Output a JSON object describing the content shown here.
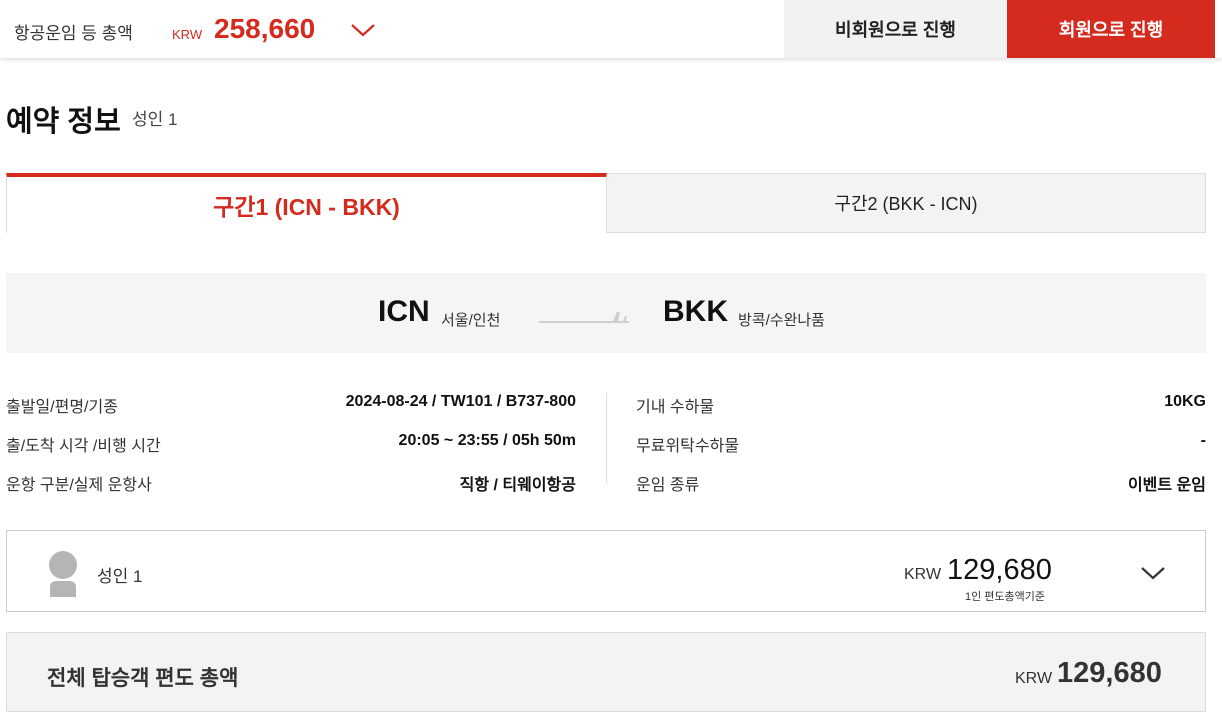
{
  "header": {
    "total_label": "항공운임 등 총액",
    "currency": "KRW",
    "total_amount": "258,660",
    "guest_button": "비회원으로 진행",
    "member_button": "회원으로 진행",
    "accent_color": "#d52b1e"
  },
  "booking": {
    "title": "예약 정보",
    "subtitle": "성인 1"
  },
  "tabs": [
    {
      "label": "구간1 (ICN - BKK)",
      "active": true
    },
    {
      "label": "구간2 (BKK - ICN)",
      "active": false
    }
  ],
  "route": {
    "departure_code": "ICN",
    "departure_city": "서울/인천",
    "arrival_code": "BKK",
    "arrival_city": "방콕/수완나품"
  },
  "details_left": [
    {
      "label": "출발일/편명/기종",
      "value": "2024-08-24 / TW101 / B737-800"
    },
    {
      "label": "출/도착 시각 /비행 시간",
      "value": "20:05 ~ 23:55 / 05h 50m"
    },
    {
      "label": "운항 구분/실제 운항사",
      "value": "직항 / 티웨이항공"
    }
  ],
  "details_right": [
    {
      "label": "기내 수하물",
      "value": "10KG"
    },
    {
      "label": "무료위탁수하물",
      "value": "-"
    },
    {
      "label": "운임 종류",
      "value": "이벤트 운임"
    }
  ],
  "passenger": {
    "label": "성인 1",
    "currency": "KRW",
    "amount": "129,680",
    "note": "1인 편도총액기준"
  },
  "grand_total": {
    "label": "전체 탑승객 편도 총액",
    "currency": "KRW",
    "amount": "129,680"
  }
}
